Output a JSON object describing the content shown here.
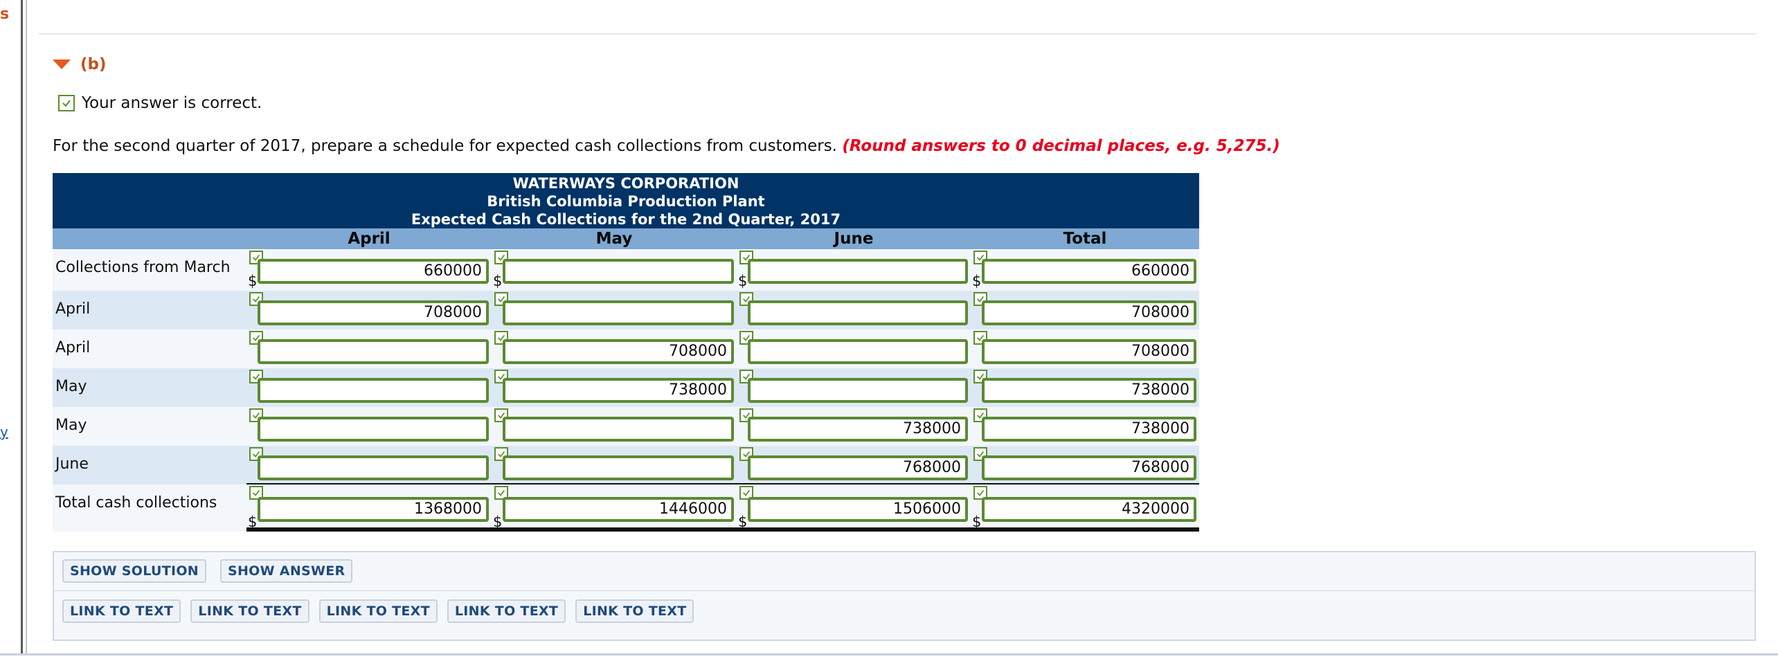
{
  "gutter": {
    "fragment_top": "s",
    "fragment_mid": "y"
  },
  "part": {
    "label": "(b)"
  },
  "status": {
    "text": "Your answer is correct."
  },
  "instruction": {
    "text": "For the second quarter of 2017, prepare a schedule for expected cash collections from customers.",
    "hint": "(Round answers to 0 decimal places, e.g. 5,275.)"
  },
  "schedule": {
    "company": "WATERWAYS CORPORATION",
    "division": "British Columbia Production Plant",
    "title": "Expected Cash Collections for the 2nd Quarter, 2017",
    "columns": [
      "April",
      "May",
      "June",
      "Total"
    ],
    "rows": [
      {
        "label": "Collections from March",
        "dollar": true,
        "values": [
          "660000",
          "",
          "",
          "660000"
        ]
      },
      {
        "label": "April",
        "dollar": false,
        "values": [
          "708000",
          "",
          "",
          "708000"
        ]
      },
      {
        "label": "April",
        "dollar": false,
        "values": [
          "",
          "708000",
          "",
          "708000"
        ]
      },
      {
        "label": "May",
        "dollar": false,
        "values": [
          "",
          "738000",
          "",
          "738000"
        ]
      },
      {
        "label": "May",
        "dollar": false,
        "values": [
          "",
          "",
          "738000",
          "738000"
        ]
      },
      {
        "label": "June",
        "dollar": false,
        "values": [
          "",
          "",
          "768000",
          "768000"
        ]
      },
      {
        "label": "Total cash collections",
        "dollar": true,
        "values": [
          "1368000",
          "1446000",
          "1506000",
          "4320000"
        ]
      }
    ],
    "currency_symbol": "$"
  },
  "buttons": {
    "show_solution": "SHOW SOLUTION",
    "show_answer": "SHOW ANSWER",
    "links": [
      "LINK TO TEXT",
      "LINK TO TEXT",
      "LINK TO TEXT",
      "LINK TO TEXT",
      "LINK TO TEXT"
    ]
  },
  "colors": {
    "header_bg": "#003366",
    "colhead_bg": "#7fa8d2",
    "correct_green": "#5c8a32",
    "hint_red": "#e8001c",
    "part_orange": "#e55a1b"
  }
}
